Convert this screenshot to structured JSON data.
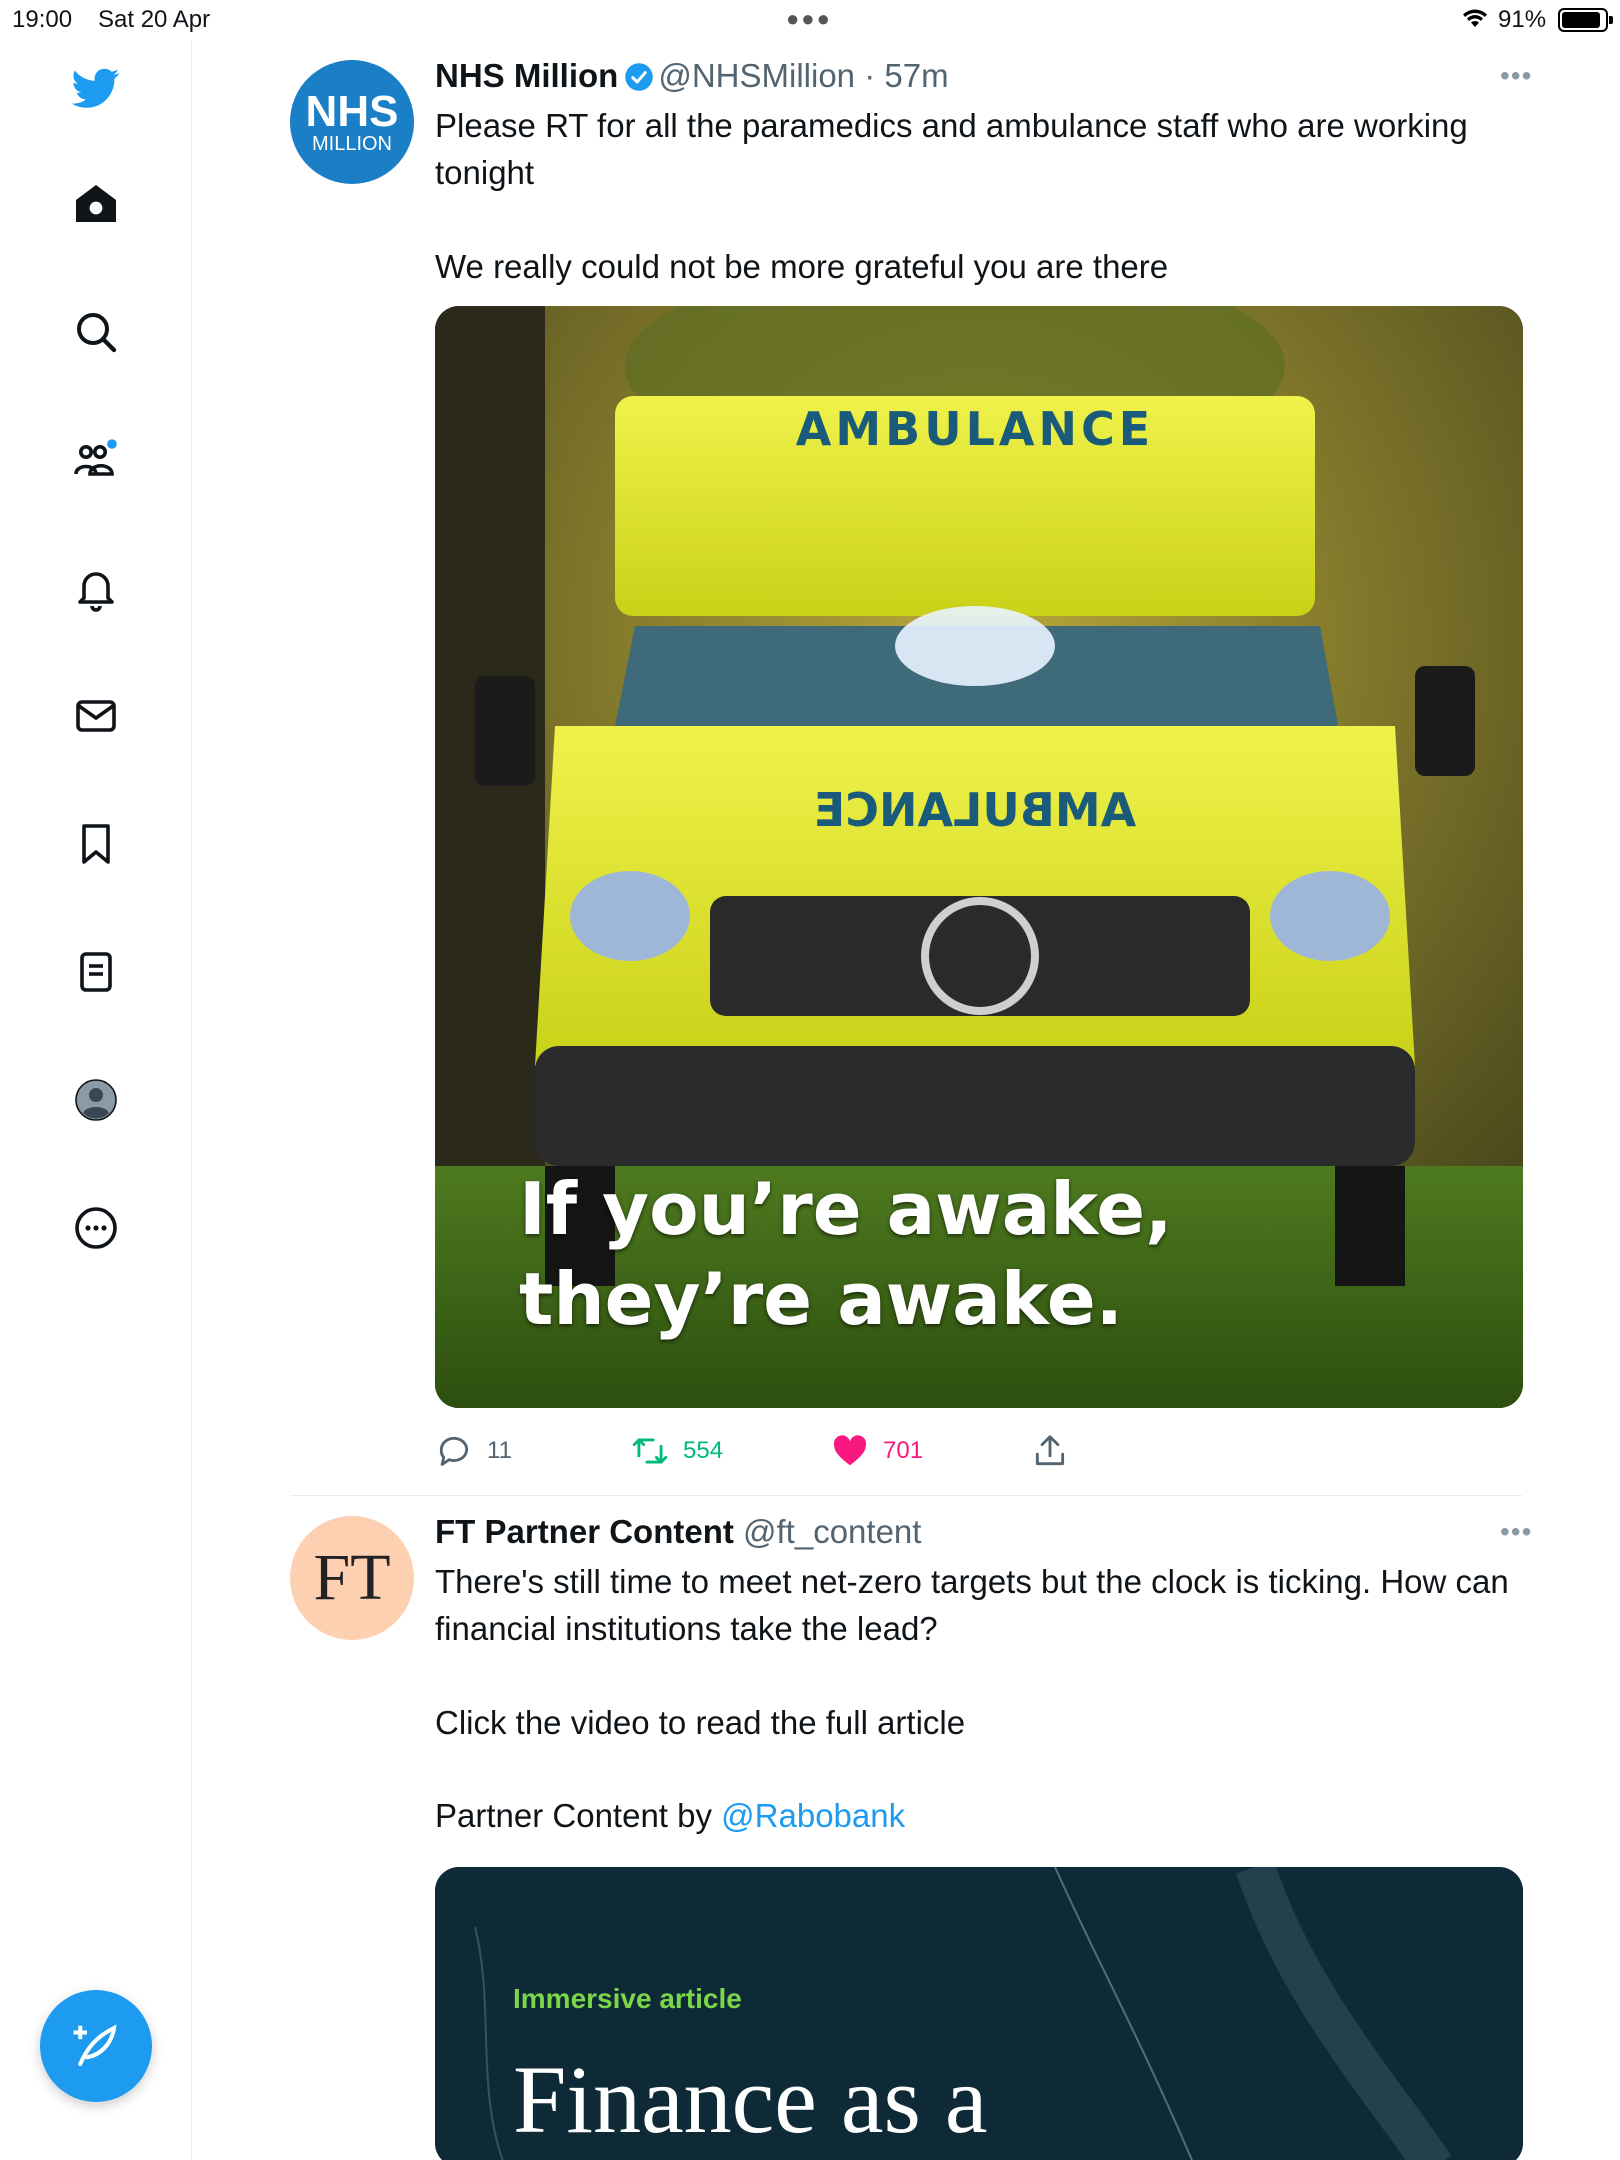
{
  "status_bar": {
    "time": "19:00",
    "date": "Sat 20 Apr",
    "battery": "91%",
    "battery_level": 0.91
  },
  "sidebar": {
    "items": [
      "twitter-logo",
      "home",
      "explore",
      "communities",
      "notifications",
      "messages",
      "bookmarks",
      "lists",
      "profile",
      "more"
    ],
    "accent": "#1d9bf0"
  },
  "tweets": [
    {
      "name": "NHS Million",
      "handle": "@NHSMillion",
      "separator": "·",
      "time": "57m",
      "avatar_line1": "NHS",
      "avatar_line2": "MILLION",
      "text": "Please RT for all the paramedics and ambulance staff who are working tonight\n\nWe really could not be more grateful you are there",
      "media": {
        "sign_top": "AMBULANCE",
        "caption_line1": "If you’re awake,",
        "caption_line2": "they’re awake."
      },
      "replies": "11",
      "retweets": "554",
      "likes": "701"
    },
    {
      "name": "FT Partner Content",
      "handle": "@ft_content",
      "avatar_text": "FT",
      "text": "There's still time to meet net-zero targets but the clock is ticking. How can financial institutions take the lead?\n\nClick the video to read the full article",
      "partner_prefix": "Partner Content by ",
      "partner_link": "@Rabobank",
      "media": {
        "kicker": "Immersive article",
        "title": "Finance as a"
      }
    }
  ]
}
